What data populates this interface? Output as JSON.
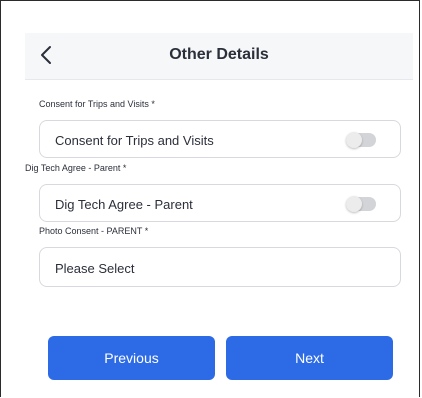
{
  "header": {
    "title": "Other Details",
    "back_icon": "chevron-left-icon"
  },
  "fields": [
    {
      "label": "Consent for Trips and Visits *",
      "value": "Consent for Trips and Visits",
      "type": "toggle",
      "checked": false
    },
    {
      "label": "Dig Tech Agree - Parent *",
      "value": "Dig Tech Agree - Parent",
      "type": "toggle",
      "checked": false
    },
    {
      "label": "Photo Consent - PARENT *",
      "value": "Please Select",
      "type": "select"
    }
  ],
  "footer": {
    "previous_label": "Previous",
    "next_label": "Next"
  },
  "colors": {
    "primary_button": "#2d6be6",
    "header_bg": "#f6f7f9",
    "toggle_off": "#d3d4d8"
  }
}
